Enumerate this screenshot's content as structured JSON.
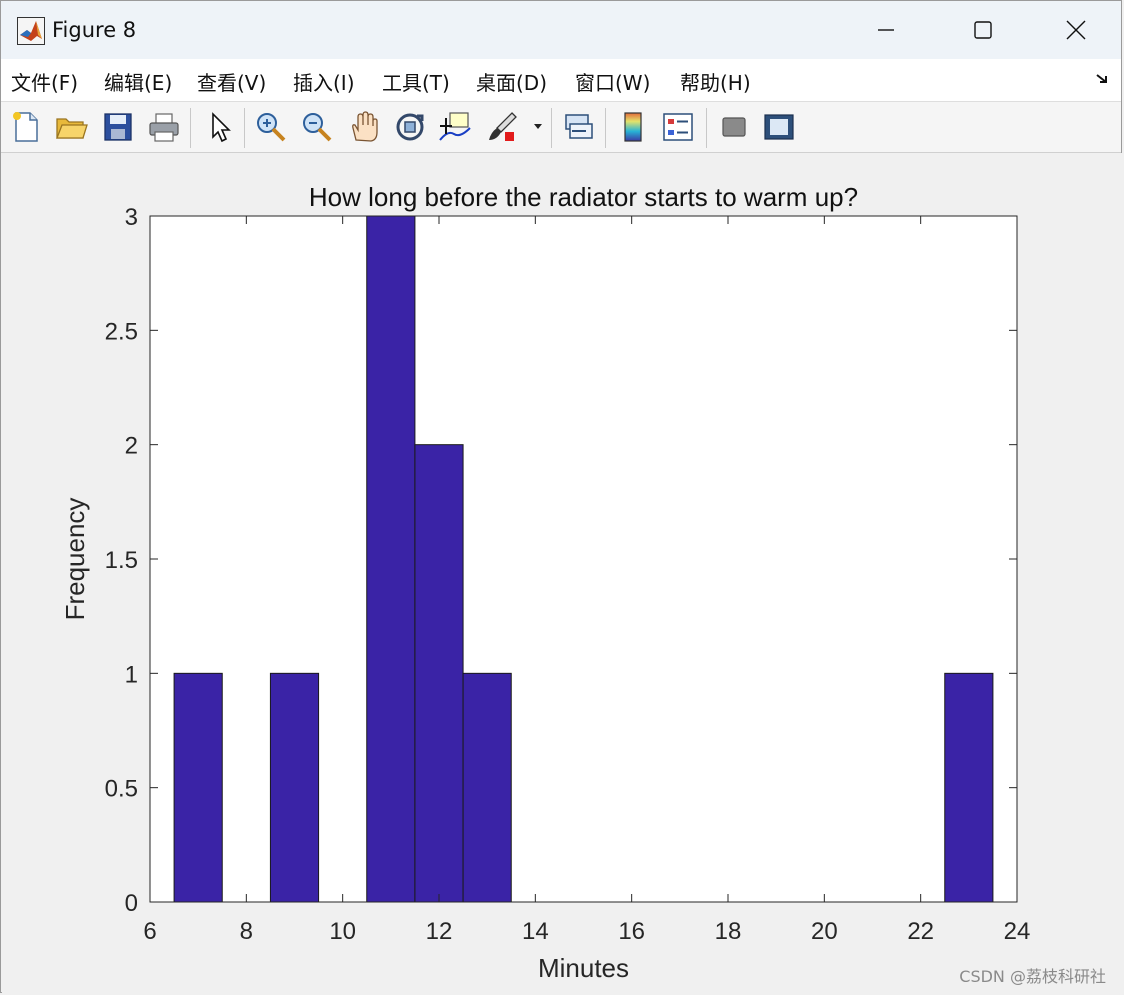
{
  "window": {
    "title": "Figure 8"
  },
  "menu": {
    "items": [
      "文件(F)",
      "编辑(E)",
      "查看(V)",
      "插入(I)",
      "工具(T)",
      "桌面(D)",
      "窗口(W)",
      "帮助(H)"
    ]
  },
  "toolbar": {
    "icons": [
      "new-file-icon",
      "open-folder-icon",
      "save-icon",
      "print-icon",
      "pointer-icon",
      "zoom-in-icon",
      "zoom-out-icon",
      "pan-hand-icon",
      "rotate-3d-icon",
      "data-cursor-icon",
      "brush-icon",
      "link-plot-icon",
      "colorbar-icon",
      "legend-icon",
      "hide-plot-tools-icon",
      "show-plot-tools-icon"
    ]
  },
  "colors": {
    "bar_fill": "#3a23a6",
    "bar_edge": "#1a1a1a",
    "axes_bg": "#ffffff",
    "figure_bg": "#f0f0f0"
  },
  "watermark": "CSDN @荔枝科研社",
  "chart_data": {
    "type": "bar",
    "subtype": "histogram",
    "title": "How long before the radiator starts to warm up?",
    "xlabel": "Minutes",
    "ylabel": "Frequency",
    "xlim": [
      6,
      24
    ],
    "ylim": [
      0,
      3
    ],
    "xticks": [
      6,
      8,
      10,
      12,
      14,
      16,
      18,
      20,
      22,
      24
    ],
    "yticks": [
      0,
      0.5,
      1,
      1.5,
      2,
      2.5,
      3
    ],
    "ytick_labels": [
      "0",
      "0.5",
      "1",
      "1.5",
      "2",
      "2.5",
      "3"
    ],
    "bin_width": 1,
    "bins": [
      {
        "start": 6.5,
        "end": 7.5,
        "count": 1
      },
      {
        "start": 7.5,
        "end": 8.5,
        "count": 0
      },
      {
        "start": 8.5,
        "end": 9.5,
        "count": 1
      },
      {
        "start": 9.5,
        "end": 10.5,
        "count": 0
      },
      {
        "start": 10.5,
        "end": 11.5,
        "count": 3
      },
      {
        "start": 11.5,
        "end": 12.5,
        "count": 2
      },
      {
        "start": 12.5,
        "end": 13.5,
        "count": 1
      },
      {
        "start": 13.5,
        "end": 14.5,
        "count": 0
      },
      {
        "start": 14.5,
        "end": 15.5,
        "count": 0
      },
      {
        "start": 15.5,
        "end": 16.5,
        "count": 0
      },
      {
        "start": 16.5,
        "end": 17.5,
        "count": 0
      },
      {
        "start": 17.5,
        "end": 18.5,
        "count": 0
      },
      {
        "start": 18.5,
        "end": 19.5,
        "count": 0
      },
      {
        "start": 19.5,
        "end": 20.5,
        "count": 0
      },
      {
        "start": 20.5,
        "end": 21.5,
        "count": 0
      },
      {
        "start": 21.5,
        "end": 22.5,
        "count": 0
      },
      {
        "start": 22.5,
        "end": 23.5,
        "count": 1
      }
    ],
    "grid": false,
    "legend": "none"
  }
}
